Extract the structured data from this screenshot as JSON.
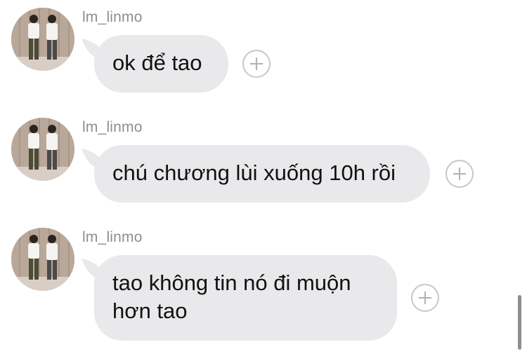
{
  "messages": [
    {
      "sender": "lm_linmo",
      "text_lines": [
        "ok để tao"
      ],
      "avatar_icon": "user-avatar",
      "action_icon": "add-reaction-icon"
    },
    {
      "sender": "lm_linmo",
      "text_lines": [
        "chú chương lùi xuống 10h rồi"
      ],
      "avatar_icon": "user-avatar",
      "action_icon": "add-reaction-icon"
    },
    {
      "sender": "lm_linmo",
      "text_lines": [
        "tao không tin nó đi muộn",
        "hơn tao"
      ],
      "avatar_icon": "user-avatar",
      "action_icon": "add-reaction-icon"
    }
  ],
  "colors": {
    "bubble": "#e9e9eb",
    "sender": "#8e8e93",
    "text": "#111111",
    "icon_border": "#c7c7cc",
    "avatar_bg": "#cdbfb3"
  }
}
